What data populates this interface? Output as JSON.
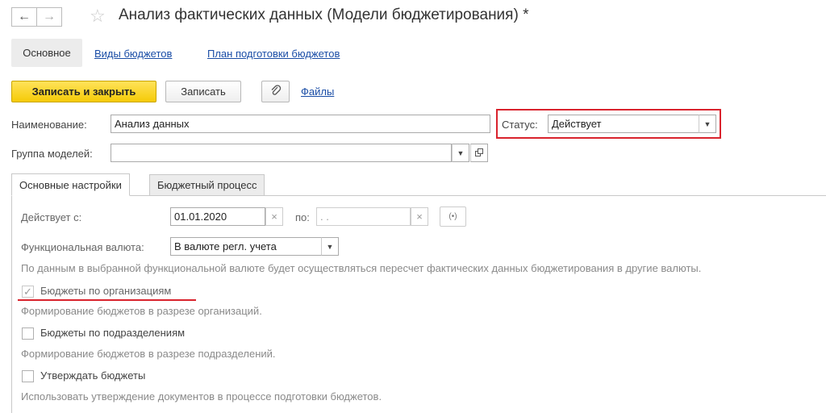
{
  "header": {
    "back_icon": "arrow-left",
    "forward_icon": "arrow-right",
    "favorite_icon": "star",
    "title": "Анализ фактических данных (Модели бюджетирования) *"
  },
  "nav": {
    "tabs": [
      "Основное",
      "Виды бюджетов",
      "План подготовки бюджетов"
    ]
  },
  "toolbar": {
    "save_close_label": "Записать и закрыть",
    "save_label": "Записать",
    "files_label": "Файлы"
  },
  "form": {
    "name_label": "Наименование:",
    "name_value": "Анализ данных",
    "status_label": "Статус:",
    "status_value": "Действует",
    "group_label": "Группа моделей:",
    "group_value": ""
  },
  "tabs": [
    "Основные настройки",
    "Бюджетный процесс"
  ],
  "settings": {
    "valid_from_label": "Действует с:",
    "valid_from_value": "01.01.2020",
    "to_label": "по:",
    "to_value": " .  .",
    "currency_label": "Функциональная валюта:",
    "currency_value": "В валюте регл. учета",
    "currency_hint": "По данным в выбранной функциональной валюте будет осуществляться пересчет фактических данных бюджетирования в другие валюты.",
    "options": [
      {
        "label": "Бюджеты по организациям",
        "hint": "Формирование бюджетов в разрезе организаций.",
        "checked": true
      },
      {
        "label": "Бюджеты по подразделениям",
        "hint": "Формирование бюджетов в разрезе подразделений.",
        "checked": false
      },
      {
        "label": "Утверждать бюджеты",
        "hint": "Использовать утверждение документов в процессе подготовки бюджетов.",
        "checked": false
      }
    ]
  },
  "colors": {
    "primary_button": "#f5cb07",
    "link": "#1a4da6",
    "highlight_red": "#d9232d"
  }
}
